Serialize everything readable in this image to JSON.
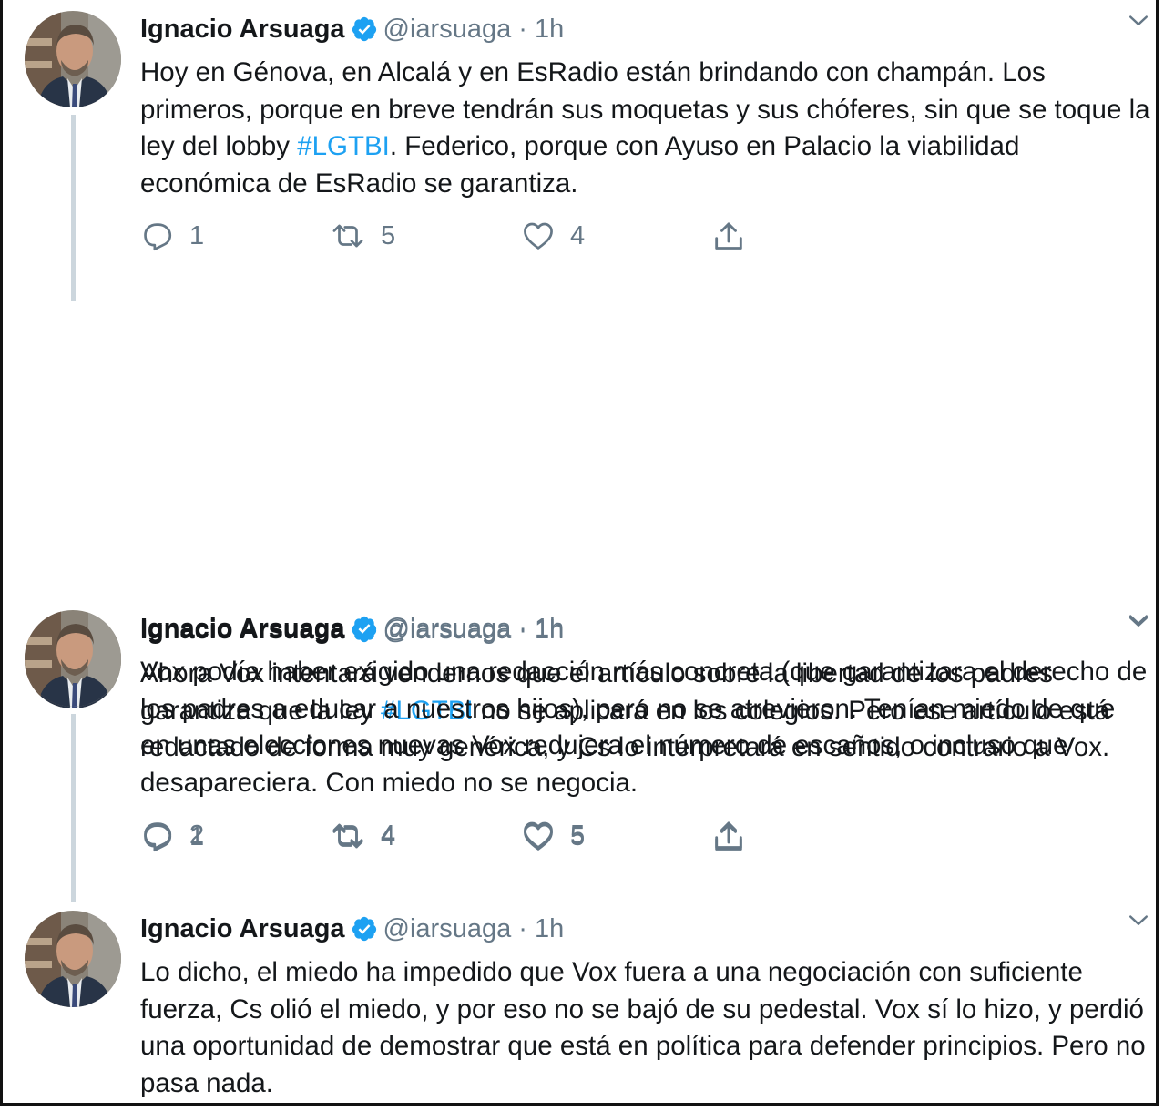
{
  "tweets": [
    {
      "name": "Ignacio Arsuaga",
      "handle": "@iarsuaga",
      "dot": "·",
      "time": "1h",
      "text_parts": [
        "Hoy en Génova, en Alcalá y en EsRadio están brindando con champán. Los primeros, porque en breve tendrán sus moquetas y sus chóferes, sin que se toque la ley del lobby ",
        "#LGTBI",
        ". Federico, porque con Ayuso en Palacio la viabilidad económica de EsRadio se garantiza."
      ],
      "replies": "1",
      "retweets": "5",
      "likes": "4"
    },
    {
      "name": "Ignacio Arsuaga",
      "handle": "@iarsuaga",
      "dot": "·",
      "time": "1h",
      "text_parts": [
        "Ahora Vox intentará vendernos que el artículo sobre la libertad de los padres garantiza que la ley ",
        "#LGTBI",
        " no se aplicará en los colegios. Pero ese artículo está redactado de forma muy genérica, y Cs lo interpretará en sentido contrario a Vox."
      ],
      "replies": "1",
      "retweets": "4",
      "likes": "5"
    },
    {
      "name": "Ignacio Arsuaga",
      "handle": "@iarsuaga",
      "dot": "·",
      "time": "1h",
      "text_parts": [
        "Vox podía haber exigido una redacción más concreta (que garantizara el derecho de los padres a educar a nuestros hijos), pero no se atrevieron. Tenían miedo de que en unas elecciones nuevas Vox redujera el número de escaños, o incluso que desapareciera. Con miedo no se negocia.",
        "",
        ""
      ],
      "replies": "2",
      "retweets": "4",
      "likes": "5"
    },
    {
      "name": "Ignacio Arsuaga",
      "handle": "@iarsuaga",
      "dot": "·",
      "time": "1h",
      "text_parts": [
        "Lo dicho, el miedo ha impedido que Vox fuera a una negociación con suficiente fuerza, Cs olió el miedo, y por eso no se bajó de su pedestal. Vox sí lo hizo, y perdió una oportunidad de demostrar que está en política para defender principios. Pero no pasa nada.",
        "",
        ""
      ]
    }
  ],
  "icons": {
    "verified": "verified-badge-icon",
    "menu": "chevron-down-icon",
    "reply": "reply-icon",
    "retweet": "retweet-icon",
    "like": "heart-icon",
    "share": "share-icon"
  },
  "colors": {
    "text": "#14171a",
    "secondary": "#657786",
    "link": "#1da1f2",
    "thread_line": "#ccd6dd"
  }
}
